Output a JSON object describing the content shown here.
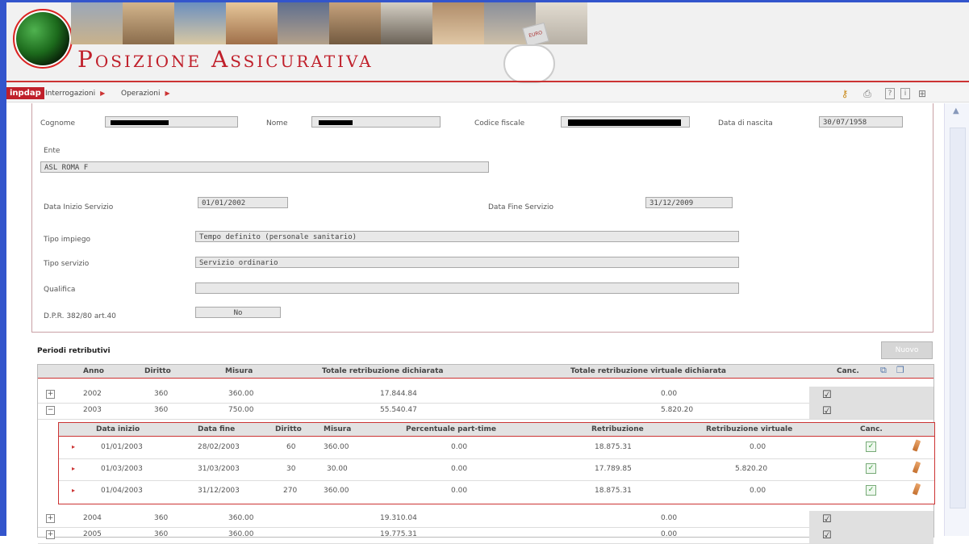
{
  "header": {
    "title": "Posizione Assicurativa",
    "coin_text": "EURO"
  },
  "menubar": {
    "logo": "inpdap",
    "items": [
      "Interrogazioni",
      "Operazioni"
    ]
  },
  "form": {
    "cognome_label": "Cognome",
    "nome_label": "Nome",
    "codice_fiscale_label": "Codice fiscale",
    "data_nascita_label": "Data di nascita",
    "data_nascita_value": "30/07/1958",
    "ente_label": "Ente",
    "ente_value": "ASL ROMA F",
    "data_inizio_label": "Data Inizio Servizio",
    "data_inizio_value": "01/01/2002",
    "data_fine_label": "Data Fine Servizio",
    "data_fine_value": "31/12/2009",
    "tipo_impiego_label": "Tipo impiego",
    "tipo_impiego_value": "Tempo definito (personale sanitario)",
    "tipo_servizio_label": "Tipo servizio",
    "tipo_servizio_value": "Servizio ordinario",
    "qualifica_label": "Qualifica",
    "qualifica_value": "",
    "dpr_label": "D.P.R. 382/80 art.40",
    "dpr_value": "No"
  },
  "periodi": {
    "title": "Periodi retributivi",
    "nuovo_label": "Nuovo",
    "headers": {
      "anno": "Anno",
      "diritto": "Diritto",
      "misura": "Misura",
      "totale": "Totale retribuzione dichiarata",
      "totale_virtuale": "Totale retribuzione virtuale dichiarata",
      "canc": "Canc."
    },
    "rows": [
      {
        "toggle": "+",
        "anno": "2002",
        "diritto": "360",
        "misura": "360.00",
        "totale": "17.844.84",
        "virtuale": "0.00"
      },
      {
        "toggle": "−",
        "anno": "2003",
        "diritto": "360",
        "misura": "750.00",
        "totale": "55.540.47",
        "virtuale": "5.820.20"
      },
      {
        "toggle": "+",
        "anno": "2004",
        "diritto": "360",
        "misura": "360.00",
        "totale": "19.310.04",
        "virtuale": "0.00"
      },
      {
        "toggle": "+",
        "anno": "2005",
        "diritto": "360",
        "misura": "360.00",
        "totale": "19.775.31",
        "virtuale": "0.00"
      }
    ],
    "sub_headers": {
      "data_inizio": "Data inizio",
      "data_fine": "Data fine",
      "diritto": "Diritto",
      "misura": "Misura",
      "percentuale": "Percentuale part-time",
      "retribuzione": "Retribuzione",
      "retribuzione_virtuale": "Retribuzione virtuale",
      "canc": "Canc."
    },
    "sub_rows": [
      {
        "data_inizio": "01/01/2003",
        "data_fine": "28/02/2003",
        "diritto": "60",
        "misura": "360.00",
        "percentuale": "0.00",
        "retribuzione": "18.875.31",
        "virtuale": "0.00"
      },
      {
        "data_inizio": "01/03/2003",
        "data_fine": "31/03/2003",
        "diritto": "30",
        "misura": "30.00",
        "percentuale": "0.00",
        "retribuzione": "17.789.85",
        "virtuale": "5.820.20"
      },
      {
        "data_inizio": "01/04/2003",
        "data_fine": "31/12/2003",
        "diritto": "270",
        "misura": "360.00",
        "percentuale": "0.00",
        "retribuzione": "18.875.31",
        "virtuale": "0.00"
      }
    ]
  }
}
